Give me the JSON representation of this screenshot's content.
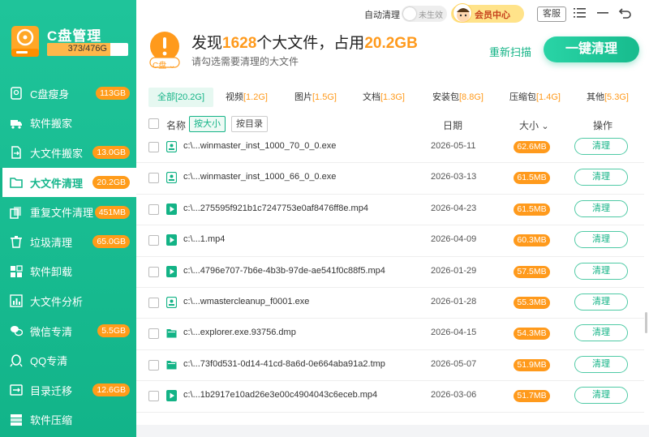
{
  "app": {
    "title": "C盘管理",
    "disk_usage": "373/476G",
    "disk_used_fraction": 0.78
  },
  "sidebar": {
    "items": [
      {
        "label": "C盘瘦身",
        "badge": "113GB",
        "icon": "disk-slim-icon"
      },
      {
        "label": "软件搬家",
        "badge": "",
        "icon": "truck-icon"
      },
      {
        "label": "大文件搬家",
        "badge": "13.0GB",
        "icon": "file-move-icon"
      },
      {
        "label": "大文件清理",
        "badge": "20.2GB",
        "icon": "folder-icon",
        "active": true
      },
      {
        "label": "重复文件清理",
        "badge": "451MB",
        "icon": "duplicate-icon"
      },
      {
        "label": "垃圾清理",
        "badge": "65.0GB",
        "icon": "trash-icon"
      },
      {
        "label": "软件卸载",
        "badge": "",
        "icon": "apps-icon"
      },
      {
        "label": "大文件分析",
        "badge": "",
        "icon": "chart-icon"
      },
      {
        "label": "微信专清",
        "badge": "5.5GB",
        "icon": "wechat-icon"
      },
      {
        "label": "QQ专清",
        "badge": "",
        "icon": "qq-icon"
      },
      {
        "label": "目录迁移",
        "badge": "12.6GB",
        "icon": "migrate-icon"
      },
      {
        "label": "软件压缩",
        "badge": "",
        "icon": "compress-icon"
      }
    ]
  },
  "topbar": {
    "auto_clean_label": "自动清理",
    "toggle_state": "未生效",
    "vip_label": "会员中心",
    "service_label": "客服"
  },
  "header": {
    "prefix": "发现",
    "count": "1628",
    "mid": "个大文件，占用",
    "size": "20.2GB",
    "subtitle": "请勾选需要清理的大文件",
    "rescan_label": "重新扫描",
    "clean_all_label": "一键清理",
    "drive_label": "C盘"
  },
  "tabs": [
    {
      "label": "全部",
      "size": "[20.2G]",
      "active": true
    },
    {
      "label": "视频",
      "size": "[1.2G]"
    },
    {
      "label": "图片",
      "size": "[1.5G]"
    },
    {
      "label": "文档",
      "size": "[1.3G]"
    },
    {
      "label": "安装包",
      "size": "[8.8G]"
    },
    {
      "label": "压缩包",
      "size": "[1.4G]"
    },
    {
      "label": "其他",
      "size": "[5.3G]"
    }
  ],
  "columns": {
    "name": "名称",
    "sort_size": "按大小",
    "sort_dir": "按目录",
    "date": "日期",
    "size": "大小",
    "action": "操作"
  },
  "files": [
    {
      "name": "c:\\...winmaster_inst_1000_70_0_0.exe",
      "date": "2026-05-11",
      "size": "62.6MB",
      "type": "exe",
      "action": "清理"
    },
    {
      "name": "c:\\...winmaster_inst_1000_66_0_0.exe",
      "date": "2026-03-13",
      "size": "61.5MB",
      "type": "exe",
      "action": "清理"
    },
    {
      "name": "c:\\...275595f921b1c7247753e0af8476ff8e.mp4",
      "date": "2026-04-23",
      "size": "61.5MB",
      "type": "video",
      "action": "清理"
    },
    {
      "name": "c:\\...1.mp4",
      "date": "2026-04-09",
      "size": "60.3MB",
      "type": "video",
      "action": "清理"
    },
    {
      "name": "c:\\...4796e707-7b6e-4b3b-97de-ae541f0c88f5.mp4",
      "date": "2026-01-29",
      "size": "57.5MB",
      "type": "video",
      "action": "清理"
    },
    {
      "name": "c:\\...wmastercleanup_f0001.exe",
      "date": "2026-01-28",
      "size": "55.3MB",
      "type": "exe",
      "action": "清理"
    },
    {
      "name": "c:\\...explorer.exe.93756.dmp",
      "date": "2026-04-15",
      "size": "54.3MB",
      "type": "folder",
      "action": "清理"
    },
    {
      "name": "c:\\...73f0d531-0d14-41cd-8a6d-0e664aba91a2.tmp",
      "date": "2026-05-07",
      "size": "51.9MB",
      "type": "folder",
      "action": "清理"
    },
    {
      "name": "c:\\...1b2917e10ad26e3e00c4904043c6eceb.mp4",
      "date": "2026-03-06",
      "size": "51.7MB",
      "type": "video",
      "action": "清理"
    }
  ],
  "colors": {
    "brand": "#14b68b",
    "accent": "#ff9a1c"
  }
}
